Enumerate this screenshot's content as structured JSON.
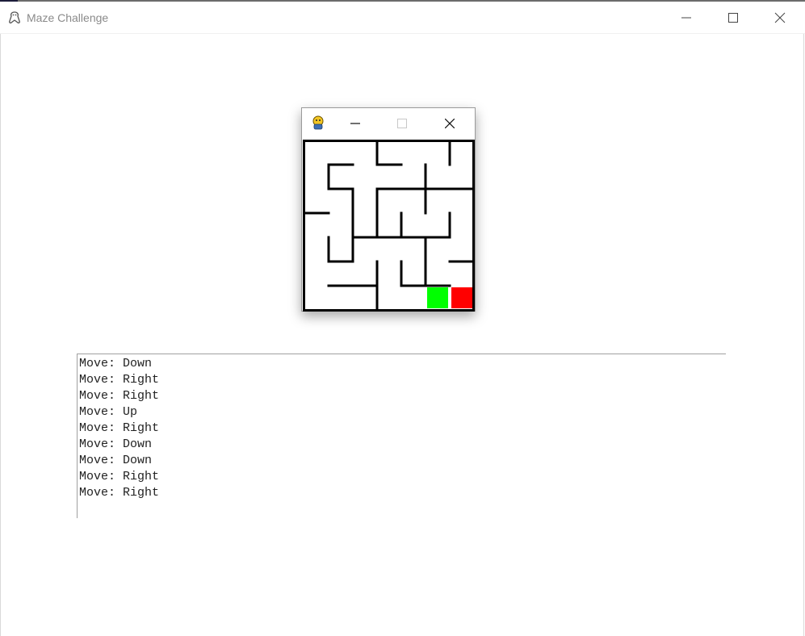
{
  "window": {
    "title": "Maze Challenge",
    "icon": "python-snake-icon"
  },
  "inner_window": {
    "icon": "pygame-icon",
    "maze": {
      "rows": 7,
      "cols": 7,
      "start_color": "#00ff00",
      "goal_color": "#ff0000",
      "wall_color": "#000000"
    }
  },
  "log": {
    "lines": [
      "Move: Down",
      "Move: Right",
      "Move: Right",
      "Move: Up",
      "Move: Right",
      "Move: Down",
      "Move: Down",
      "Move: Right",
      "Move: Right"
    ]
  }
}
